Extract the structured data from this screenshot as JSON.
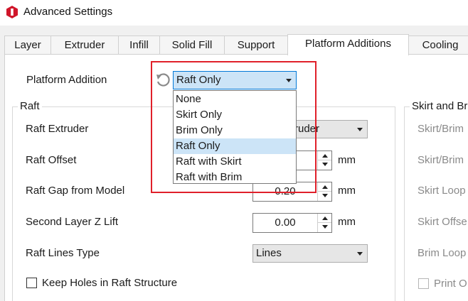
{
  "window": {
    "title": "Advanced Settings",
    "brand_color": "#d0162a"
  },
  "tabs": [
    {
      "label": "Layer"
    },
    {
      "label": "Extruder"
    },
    {
      "label": "Infill"
    },
    {
      "label": "Solid Fill"
    },
    {
      "label": "Support"
    },
    {
      "label": "Platform Additions",
      "active": true
    },
    {
      "label": "Cooling"
    }
  ],
  "platform_addition": {
    "label": "Platform Addition",
    "reset_icon": "reset-icon",
    "selected": "Raft Only",
    "options": [
      "None",
      "Skirt Only",
      "Brim Only",
      "Raft Only",
      "Raft with Skirt",
      "Raft with Brim"
    ]
  },
  "raft": {
    "title": "Raft",
    "extruder": {
      "label": "Raft Extruder",
      "value_fragment": "ruder"
    },
    "offset": {
      "label": "Raft Offset",
      "unit": "mm"
    },
    "gap": {
      "label": "Raft Gap from Model",
      "value": "0.20",
      "unit": "mm"
    },
    "z_lift": {
      "label": "Second Layer Z Lift",
      "value": "0.00",
      "unit": "mm"
    },
    "lines_type": {
      "label": "Raft Lines Type",
      "value": "Lines"
    },
    "keep_holes": {
      "label": "Keep Holes in Raft Structure",
      "checked": false
    }
  },
  "skirt": {
    "title": "Skirt and Br",
    "items": [
      "Skirt/Brim",
      "Skirt/Brim",
      "Skirt Loop",
      "Skirt Offse",
      "Brim Loop"
    ],
    "print_label": "Print O"
  }
}
